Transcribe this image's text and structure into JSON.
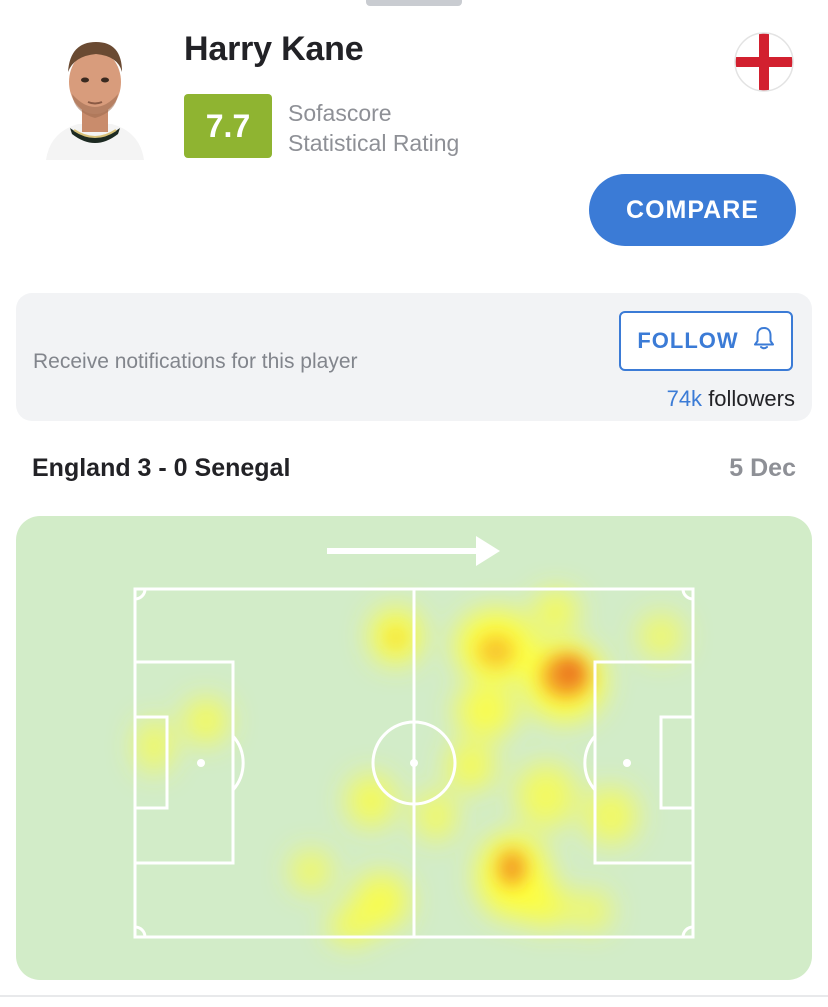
{
  "player": {
    "name": "Harry Kane",
    "rating": "7.7",
    "rating_label_line1": "Sofascore",
    "rating_label_line2": "Statistical Rating",
    "country_flag": "england-flag-icon",
    "rating_color": "#8fb431"
  },
  "actions": {
    "compare_label": "COMPARE",
    "follow_label": "FOLLOW",
    "notify_text": "Receive notifications for this player",
    "followers_count": "74k",
    "followers_label": "followers",
    "accent_color": "#3b7bd6"
  },
  "match": {
    "title": "England 3 - 0 Senegal",
    "date": "5 Dec"
  },
  "heatmap": {
    "pitch_color": "#d2ecc8",
    "attack_direction": "right",
    "icons": [
      "attack-direction-arrow-icon",
      "bell-icon"
    ]
  }
}
